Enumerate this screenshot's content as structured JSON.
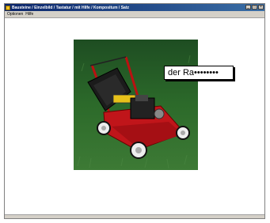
{
  "window": {
    "title": "Bausteine / Einzelbild / Tastatur / mit Hilfe / Kompositum / Satz",
    "buttons": {
      "minimize": "_",
      "maximize": "□",
      "close": "×"
    }
  },
  "menu": {
    "items": [
      {
        "label": "Optionen"
      },
      {
        "label": "Hilfe"
      }
    ]
  },
  "exercise": {
    "image_subject": "lawnmower",
    "answer_field": {
      "value": "der Ra••••••••"
    }
  }
}
